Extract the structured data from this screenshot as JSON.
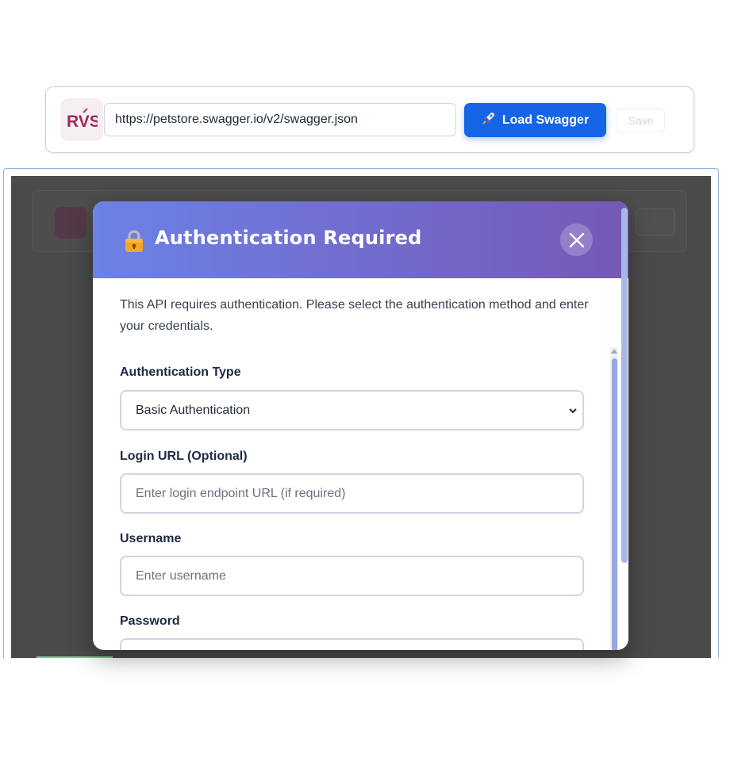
{
  "toolbar": {
    "logo_text": "RVS",
    "url_value": "https://petstore.swagger.io/v2/swagger.json",
    "load_label": "Load Swagger",
    "save_label": "Save"
  },
  "modal": {
    "title": "Authentication Required",
    "intro": "This API requires authentication. Please select the authentication method and enter your credentials.",
    "auth_type": {
      "label": "Authentication Type",
      "selected": "Basic Authentication"
    },
    "login_url": {
      "label": "Login URL (Optional)",
      "placeholder": "Enter login endpoint URL (if required)"
    },
    "username": {
      "label": "Username",
      "placeholder": "Enter username"
    },
    "password": {
      "label": "Password"
    }
  },
  "colors": {
    "header_gradient_start": "#6b82e6",
    "header_gradient_end": "#7758b5",
    "primary_button": "#1565e6",
    "overlay": "#4a4a4a"
  }
}
